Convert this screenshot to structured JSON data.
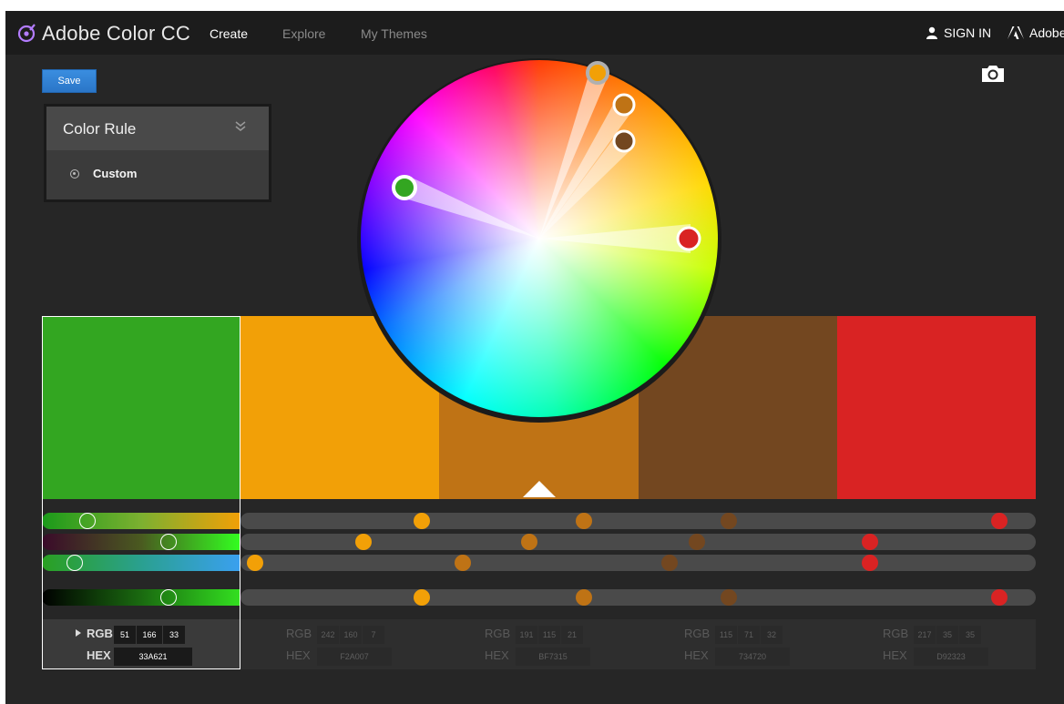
{
  "header": {
    "app_title": "Adobe Color CC",
    "nav": [
      {
        "label": "Create",
        "active": true
      },
      {
        "label": "Explore",
        "active": false
      },
      {
        "label": "My Themes",
        "active": false
      }
    ],
    "sign_in": "SIGN IN",
    "adobe_link": "Adobe"
  },
  "toolbar": {
    "save_label": "Save",
    "camera_icon": "camera-icon"
  },
  "color_rule": {
    "title": "Color Rule",
    "selected_option": "Custom"
  },
  "colors": {
    "accent_blue": "#2a7fd4",
    "background": "#262626"
  },
  "swatches": [
    {
      "hex": "33A621",
      "rgb": [
        51,
        166,
        33
      ],
      "color": "#33A621",
      "selected": true
    },
    {
      "hex": "F2A007",
      "rgb": [
        242,
        160,
        7
      ],
      "color": "#F2A007",
      "selected": false
    },
    {
      "hex": "BF7315",
      "rgb": [
        191,
        115,
        21
      ],
      "color": "#BF7315",
      "selected": false
    },
    {
      "hex": "734720",
      "rgb": [
        115,
        71,
        32
      ],
      "color": "#734720",
      "selected": false
    },
    {
      "hex": "D92323",
      "rgb": [
        217,
        35,
        35
      ],
      "color": "#D92323",
      "selected": false
    }
  ],
  "labels": {
    "rgb": "RGB",
    "hex": "HEX"
  }
}
